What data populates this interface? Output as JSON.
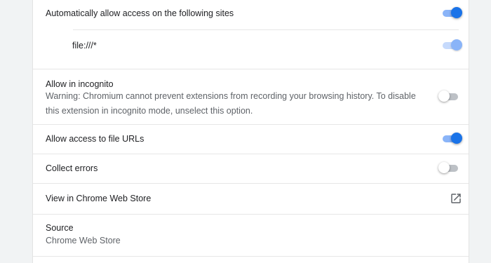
{
  "site_access": {
    "auto_allow_label": "Automatically allow access on the following sites",
    "auto_allow_enabled": true,
    "sites": [
      {
        "pattern": "file:///*",
        "enabled": true
      }
    ]
  },
  "incognito": {
    "title": "Allow in incognito",
    "warning": "Warning: Chromium cannot prevent extensions from recording your browsing history. To disable this extension in incognito mode, unselect this option.",
    "enabled": false
  },
  "file_urls": {
    "label": "Allow access to file URLs",
    "enabled": true
  },
  "collect_errors": {
    "label": "Collect errors",
    "enabled": false
  },
  "web_store": {
    "label": "View in Chrome Web Store",
    "icon": "open-in-new-icon"
  },
  "source": {
    "title": "Source",
    "value": "Chrome Web Store"
  },
  "colors": {
    "accent": "#1a73e8",
    "accent_track": "#8ab4f8",
    "off_track": "#bdc1c6",
    "background": "#f1f3f4",
    "card": "#ffffff"
  }
}
